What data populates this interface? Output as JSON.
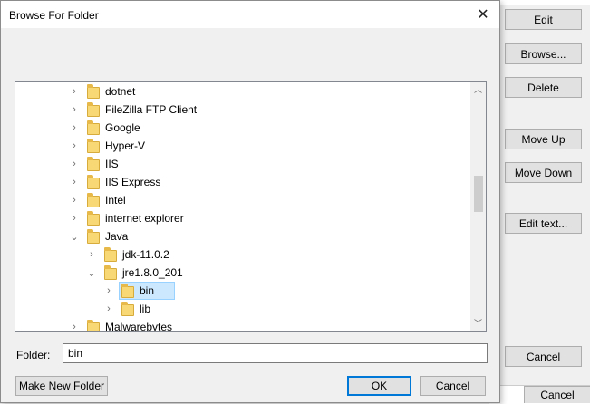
{
  "background_dialog": {
    "buttons": [
      "Edit",
      "Browse...",
      "Delete",
      "Move Up",
      "Move Down",
      "Edit text...",
      "Cancel"
    ],
    "bottom_cancel": "Cancel"
  },
  "dialog": {
    "title": "Browse For Folder",
    "tree": [
      {
        "label": "dotnet",
        "level": 0,
        "chevron": "right"
      },
      {
        "label": "FileZilla FTP Client",
        "level": 0,
        "chevron": "right"
      },
      {
        "label": "Google",
        "level": 0,
        "chevron": "right"
      },
      {
        "label": "Hyper-V",
        "level": 0,
        "chevron": "right"
      },
      {
        "label": "IIS",
        "level": 0,
        "chevron": "right"
      },
      {
        "label": "IIS Express",
        "level": 0,
        "chevron": "right"
      },
      {
        "label": "Intel",
        "level": 0,
        "chevron": "right"
      },
      {
        "label": "internet explorer",
        "level": 0,
        "chevron": "right"
      },
      {
        "label": "Java",
        "level": 0,
        "chevron": "down"
      },
      {
        "label": "jdk-11.0.2",
        "level": 1,
        "chevron": "right"
      },
      {
        "label": "jre1.8.0_201",
        "level": 1,
        "chevron": "down"
      },
      {
        "label": "bin",
        "level": 2,
        "chevron": "right",
        "selected": true
      },
      {
        "label": "lib",
        "level": 2,
        "chevron": "right"
      },
      {
        "label": "Malwarebytes",
        "level": 0,
        "chevron": "right"
      }
    ],
    "folder_label": "Folder:",
    "folder_value": "bin",
    "make_new_folder": "Make New Folder",
    "ok": "OK",
    "cancel": "Cancel"
  }
}
